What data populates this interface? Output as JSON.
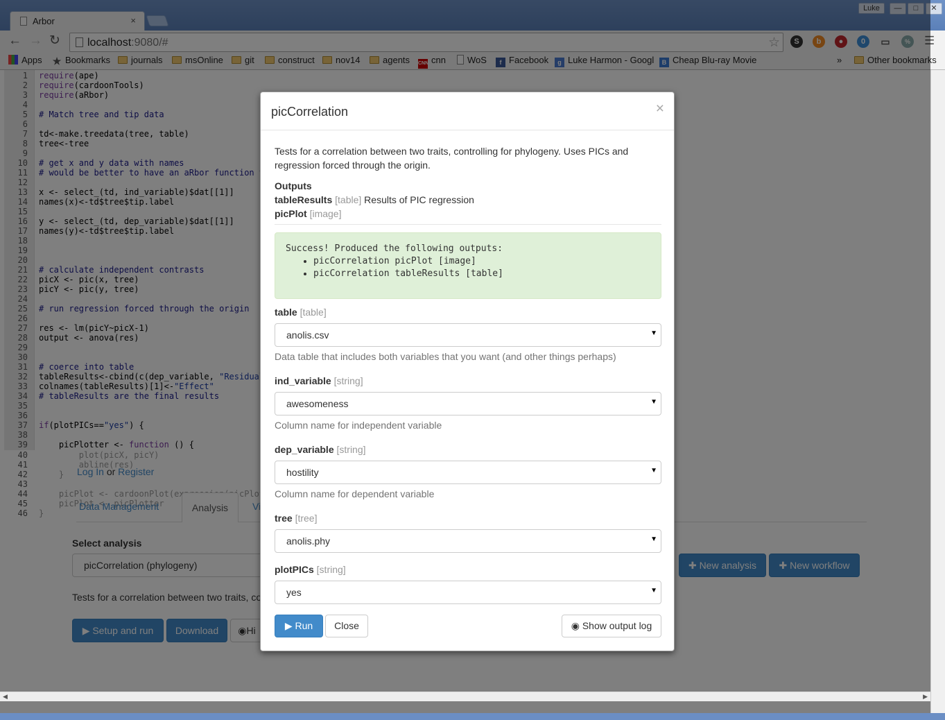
{
  "browser": {
    "tab_title": "Arbor",
    "tab_close": "×",
    "user_name": "Luke",
    "url_host": "localhost",
    "url_rest": ":9080/#",
    "window_min": "—",
    "window_max": "□",
    "window_close": "✕",
    "ext_badge": "0",
    "ext_pct": "%"
  },
  "bookmarks": [
    {
      "label": "Apps",
      "icon": "apps-icon"
    },
    {
      "label": "Bookmarks",
      "icon": "star-icon"
    },
    {
      "label": "journals",
      "icon": "folder-icon"
    },
    {
      "label": "msOnline",
      "icon": "folder-icon"
    },
    {
      "label": "git",
      "icon": "folder-icon"
    },
    {
      "label": "construct",
      "icon": "folder-icon"
    },
    {
      "label": "nov14",
      "icon": "folder-icon"
    },
    {
      "label": "agents",
      "icon": "folder-icon"
    },
    {
      "label": "cnn",
      "icon": "cnn-icon"
    },
    {
      "label": "WoS",
      "icon": "page-icon"
    },
    {
      "label": "Facebook",
      "icon": "facebook-icon"
    },
    {
      "label": "Luke Harmon - Googl",
      "icon": "scholar-icon"
    },
    {
      "label": "Cheap Blu-ray Movie",
      "icon": "b-icon"
    }
  ],
  "bookmarks_more": "»",
  "bookmarks_other": "Other bookmarks",
  "code_lines": [
    "require(ape)",
    "require(cardoonTools)",
    "require(aRbor)",
    "",
    "# Match tree and tip data",
    "",
    "td<-make.treedata(tree, table)",
    "tree<-tree",
    "",
    "# get x and y data with names",
    "# would be better to have an aRbor function th",
    "",
    "x <- select_(td, ind_variable)$dat[[1]]",
    "names(x)<-td$tree$tip.label",
    "",
    "y <- select_(td, dep_variable)$dat[[1]]",
    "names(y)<-td$tree$tip.label",
    "",
    "",
    "",
    "# calculate independent contrasts",
    "picX <- pic(x, tree)",
    "picY <- pic(y, tree)",
    "",
    "# run regression forced through the origin",
    "",
    "res <- lm(picY~picX-1)",
    "output <- anova(res)",
    "",
    "",
    "# coerce into table",
    "tableResults<-cbind(c(dep_variable, \"Residuals",
    "colnames(tableResults)[1]<-\"Effect\"",
    "# tableResults are the final results",
    "",
    "",
    "if(plotPICs==\"yes\") {",
    "",
    "    picPlotter <- function () {"
  ],
  "code_faded": [
    "        plot(picX, picY)",
    "        abline(res)",
    "    }",
    "",
    "    picPlot <- cardoonPlot(expression(picPlot",
    "    picPlot <- picPlotter",
    "}"
  ],
  "app": {
    "login": "Log In",
    "or": "or",
    "register": "Register",
    "tabs": [
      "Data Management",
      "Analysis",
      "Vi"
    ],
    "select_analysis_label": "Select analysis",
    "analysis_value": "picCorrelation (phylogeny)",
    "new_analysis": "New analysis",
    "new_workflow": "New workflow",
    "description": "Tests for a correlation between two traits, co",
    "setup_run": "Setup and run",
    "download": "Download",
    "hide": "Hi"
  },
  "modal": {
    "title": "picCorrelation",
    "close": "×",
    "description": "Tests for a correlation between two traits, controlling for phylogeny. Uses PICs and regression forced through the origin.",
    "outputs_label": "Outputs",
    "outputs": [
      {
        "name": "tableResults",
        "type": "[table]",
        "desc": "Results of PIC regression"
      },
      {
        "name": "picPlot",
        "type": "[image]",
        "desc": ""
      }
    ],
    "success_title": "Success! Produced the following outputs:",
    "success_items": [
      "picCorrelation picPlot [image]",
      "picCorrelation tableResults [table]"
    ],
    "fields": [
      {
        "name": "table",
        "type": "[table]",
        "value": "anolis.csv",
        "help": "Data table that includes both variables that you want (and other things perhaps)"
      },
      {
        "name": "ind_variable",
        "type": "[string]",
        "value": "awesomeness",
        "help": "Column name for independent variable"
      },
      {
        "name": "dep_variable",
        "type": "[string]",
        "value": "hostility",
        "help": "Column name for dependent variable"
      },
      {
        "name": "tree",
        "type": "[tree]",
        "value": "anolis.phy",
        "help": ""
      },
      {
        "name": "plotPICs",
        "type": "[string]",
        "value": "yes",
        "help": ""
      }
    ],
    "run": "Run",
    "close_btn": "Close",
    "show_log": "Show output log"
  }
}
